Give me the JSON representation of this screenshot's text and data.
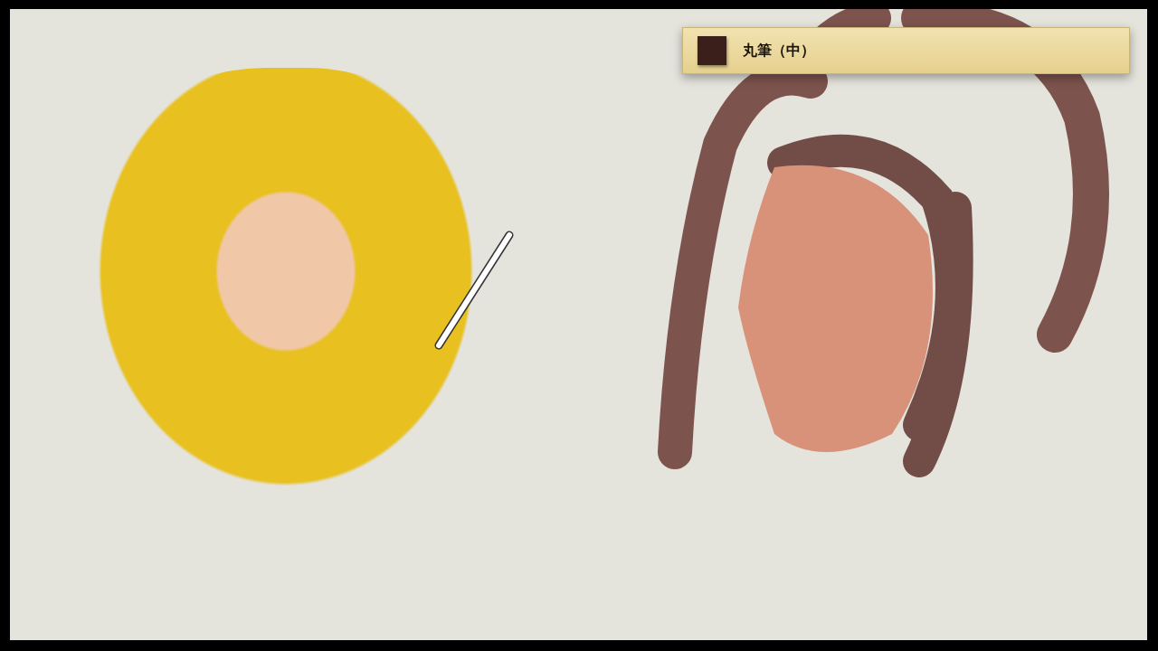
{
  "brush": {
    "name": "丸筆（中）",
    "color": "#3a1f1a"
  }
}
